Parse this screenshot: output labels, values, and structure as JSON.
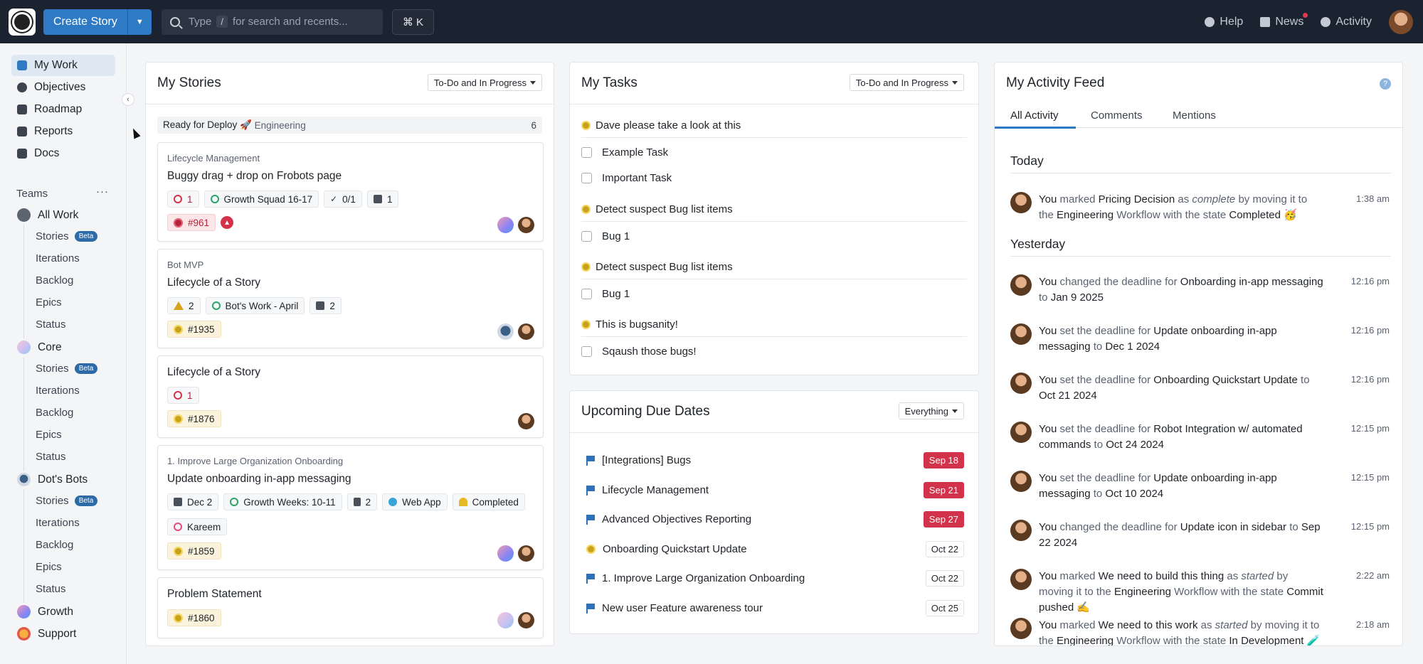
{
  "topbar": {
    "create_label": "Create Story",
    "search_prefix": "Type",
    "search_slash": "/",
    "search_suffix": "for search and recents...",
    "shortcut": "⌘ K",
    "help": "Help",
    "news": "News",
    "activity": "Activity"
  },
  "sidebar": {
    "nav": [
      "My Work",
      "Objectives",
      "Roadmap",
      "Reports",
      "Docs"
    ],
    "teams_label": "Teams",
    "teams_more": "···",
    "all_work": "All Work",
    "subs": {
      "stories": "Stories",
      "beta": "Beta",
      "iterations": "Iterations",
      "backlog": "Backlog",
      "epics": "Epics",
      "status": "Status"
    },
    "teams": [
      "Core",
      "Dot's Bots",
      "Growth",
      "Support"
    ]
  },
  "stories": {
    "title": "My Stories",
    "filter": "To-Do and In Progress",
    "group": {
      "label": "Ready for Deploy 🚀",
      "team": "Engineering",
      "count": "6"
    },
    "cards": [
      {
        "epic": "Lifecycle Management",
        "title": "Buggy drag + drop on Frobots page",
        "blocked": "1",
        "iteration": "Growth Squad 16-17",
        "tasks": "0/1",
        "docs": "1",
        "id": "#961"
      },
      {
        "epic": "Bot MVP",
        "title": "Lifecycle of a Story",
        "warn": "2",
        "iteration": "Bot's Work - April",
        "docs": "2",
        "id": "#1935"
      },
      {
        "title": "Lifecycle of a Story",
        "blocked": "1",
        "id": "#1876"
      },
      {
        "epic": "1. Improve Large Organization Onboarding",
        "title": "Update onboarding in-app messaging",
        "deadline": "Dec 2",
        "iteration": "Growth Weeks: 10-11",
        "estimate": "2",
        "product": "Web App",
        "state": "Completed",
        "owner": "Kareem",
        "id": "#1859"
      },
      {
        "title": "Problem Statement",
        "id": "#1860"
      }
    ]
  },
  "tasks": {
    "title": "My Tasks",
    "filter": "To-Do and In Progress",
    "groups": [
      {
        "name": "Dave please take a look at this",
        "items": [
          "Example Task",
          "Important Task"
        ]
      },
      {
        "name": "Detect suspect Bug list items",
        "items": [
          "Bug 1"
        ]
      },
      {
        "name": "Detect suspect Bug list items",
        "items": [
          "Bug 1"
        ]
      },
      {
        "name": "This is bugsanity!",
        "items": [
          "Sqaush those bugs!"
        ]
      }
    ]
  },
  "due": {
    "title": "Upcoming Due Dates",
    "filter": "Everything",
    "items": [
      {
        "name": "[Integrations] Bugs",
        "date": "Sep 18"
      },
      {
        "name": "Lifecycle Management",
        "date": "Sep 21"
      },
      {
        "name": "Advanced Objectives Reporting",
        "date": "Sep 27"
      },
      {
        "name": "Onboarding Quickstart Update",
        "date": "Oct 22"
      },
      {
        "name": "1. Improve Large Organization Onboarding",
        "date": "Oct 22"
      },
      {
        "name": "New user Feature awareness tour",
        "date": "Oct 25"
      }
    ]
  },
  "feed": {
    "title": "My Activity Feed",
    "help": "?",
    "tabs": [
      "All Activity",
      "Comments",
      "Mentions"
    ],
    "today": "Today",
    "yesterday": "Yesterday",
    "items": [
      {
        "time": "1:38 am",
        "you": "You",
        "a": " marked ",
        "b": "Pricing Decision",
        "c": " as ",
        "d": "complete",
        "e": " by moving it to the ",
        "f": "Engineering",
        "g": " Workflow with the state ",
        "h": "Completed 🥳"
      },
      {
        "time": "12:16 pm",
        "you": "You",
        "a": " changed the deadline for ",
        "b": "Onboarding in-app messaging",
        "c": " to ",
        "d": "Jan 9 2025"
      },
      {
        "time": "12:16 pm",
        "you": "You",
        "a": " set the deadline for ",
        "b": "Update onboarding in-app messaging",
        "c": " to ",
        "d": "Dec 1 2024"
      },
      {
        "time": "12:16 pm",
        "you": "You",
        "a": " set the deadline for ",
        "b": "Onboarding Quickstart Update",
        "c": " to ",
        "d": "Oct 21 2024"
      },
      {
        "time": "12:15 pm",
        "you": "You",
        "a": " set the deadline for ",
        "b": "Robot Integration w/ automated commands",
        "c": " to ",
        "d": "Oct 24 2024"
      },
      {
        "time": "12:15 pm",
        "you": "You",
        "a": " set the deadline for ",
        "b": "Update onboarding in-app messaging",
        "c": " to ",
        "d": "Oct 10 2024"
      },
      {
        "time": "12:15 pm",
        "you": "You",
        "a": " changed the deadline for ",
        "b": "Update icon in sidebar",
        "c": " to ",
        "d": "Sep 22 2024"
      },
      {
        "time": "2:22 am",
        "you": "You",
        "a": " marked ",
        "b": "We need to build this thing",
        "c": " as ",
        "d": "started",
        "e": " by moving it to the ",
        "f": "Engineering",
        "g": " Workflow with the state ",
        "h": "Commit pushed ✍️"
      },
      {
        "time": "2:18 am",
        "you": "You",
        "a": " marked ",
        "b": "We need to this work",
        "c": " as ",
        "d": "started",
        "e": " by moving it to the ",
        "f": "Engineering",
        "g": " Workflow with the state ",
        "h": "In Development 🧪"
      }
    ]
  }
}
